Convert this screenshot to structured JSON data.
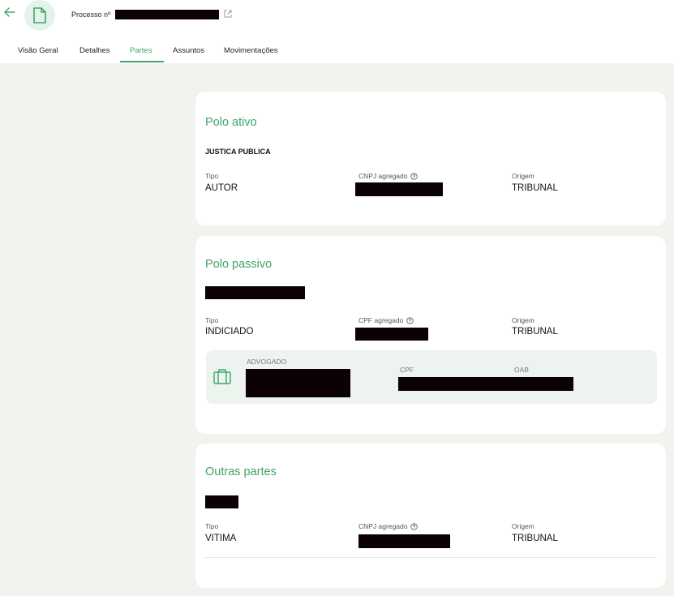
{
  "header": {
    "process_label": "Processo nº"
  },
  "tabs": [
    {
      "label": "Visão Geral"
    },
    {
      "label": "Detalhes"
    },
    {
      "label": "Partes",
      "active": true
    },
    {
      "label": "Assuntos"
    },
    {
      "label": "Movimentações"
    }
  ],
  "polo_ativo": {
    "title": "Polo ativo",
    "party_name": "JUSTICA PUBLICA",
    "tipo_label": "Tipo",
    "tipo_value": "AUTOR",
    "doc_label": "CNPJ agregado",
    "origem_label": "Origem",
    "origem_value": "TRIBUNAL"
  },
  "polo_passivo": {
    "title": "Polo passivo",
    "tipo_label": "Tipo",
    "tipo_value": "INDICIADO",
    "doc_label": "CPF agregado",
    "origem_label": "Origem",
    "origem_value": "TRIBUNAL",
    "advogado": {
      "role_label": "ADVOGADO",
      "cpf_label": "CPF",
      "oab_label": "OAB"
    }
  },
  "outras_partes": {
    "title": "Outras partes",
    "tipo_label": "Tipo",
    "tipo_value": "VITIMA",
    "doc_label": "CNPJ agregado",
    "origem_label": "Origem",
    "origem_value": "TRIBUNAL"
  },
  "colors": {
    "accent": "#3fa56a",
    "background": "#f3f2ee",
    "card": "#ffffff",
    "lawyer_box": "#edf4ef",
    "redaction": "#0c0204"
  },
  "icons": [
    "back-arrow-icon",
    "document-icon",
    "external-link-icon",
    "help-circle-icon",
    "briefcase-icon"
  ]
}
